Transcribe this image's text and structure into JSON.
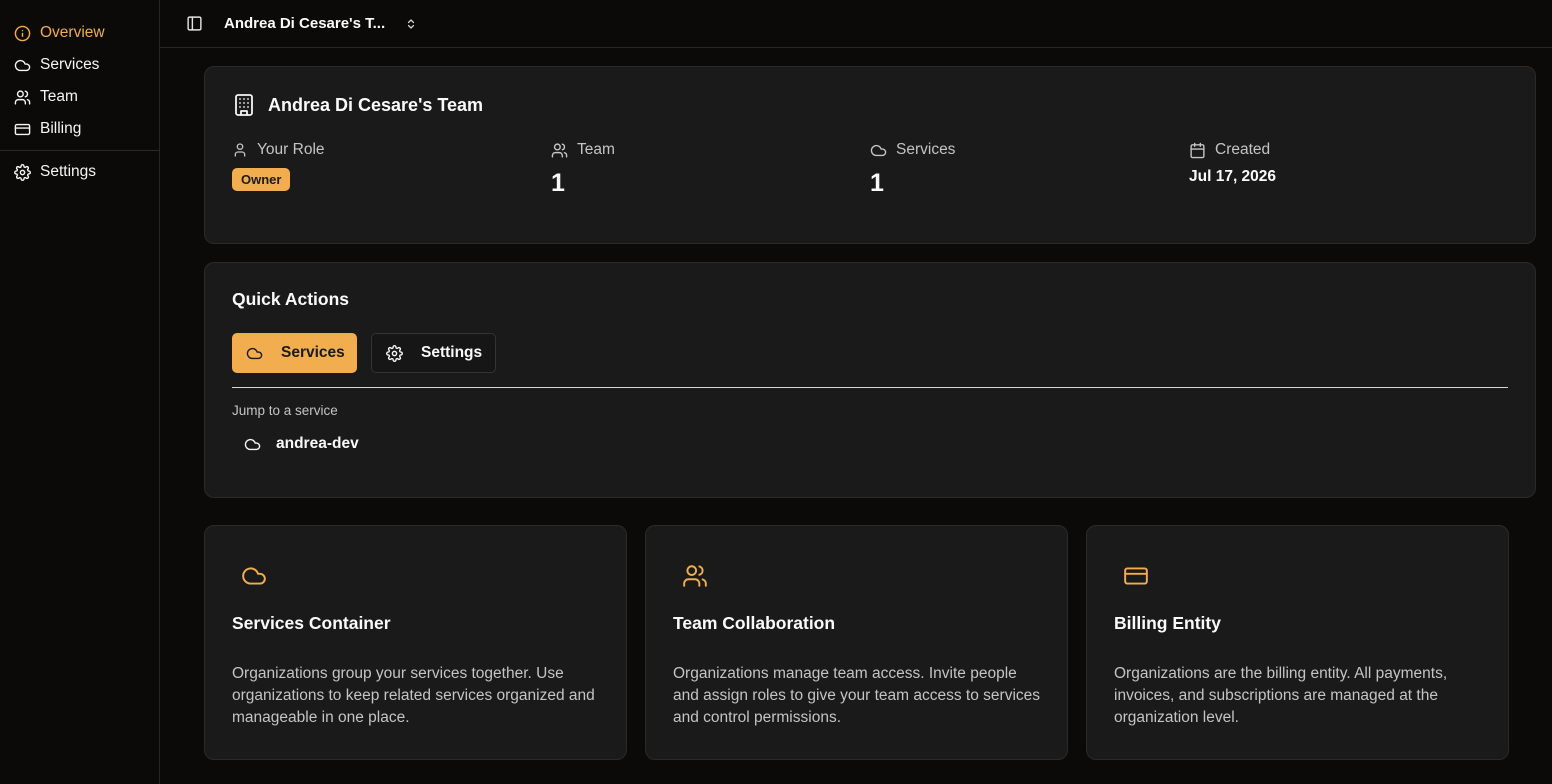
{
  "sidebar": {
    "items": [
      {
        "label": "Overview",
        "icon": "info-icon",
        "active": true
      },
      {
        "label": "Services",
        "icon": "cloud-icon"
      },
      {
        "label": "Team",
        "icon": "users-icon"
      },
      {
        "label": "Billing",
        "icon": "credit-card-icon"
      },
      {
        "label": "Settings",
        "icon": "gear-icon"
      }
    ]
  },
  "topbar": {
    "team_name": "Andrea Di Cesare's T..."
  },
  "org": {
    "title": "Andrea Di Cesare's Team",
    "stats": {
      "role_label": "Your Role",
      "role_value": "Owner",
      "team_label": "Team",
      "team_value": "1",
      "services_label": "Services",
      "services_value": "1",
      "created_label": "Created",
      "created_value": "Jul 17, 2026"
    }
  },
  "quick_actions": {
    "title": "Quick Actions",
    "services_button": "Services",
    "settings_button": "Settings",
    "jump_label": "Jump to a service",
    "services": [
      "andrea-dev"
    ]
  },
  "info_cards": [
    {
      "icon": "cloud-icon",
      "title": "Services Container",
      "text": "Organizations group your services together. Use organizations to keep related services organized and manageable in one place."
    },
    {
      "icon": "users-icon",
      "title": "Team Collaboration",
      "text": "Organizations manage team access. Invite people and assign roles to give your team access to services and control permissions."
    },
    {
      "icon": "credit-card-icon",
      "title": "Billing Entity",
      "text": "Organizations are the billing entity. All payments, invoices, and subscriptions are managed at the organization level."
    }
  ],
  "colors": {
    "accent": "#f2ad4e",
    "background": "#0c0a09",
    "card": "#1a1a1a"
  }
}
